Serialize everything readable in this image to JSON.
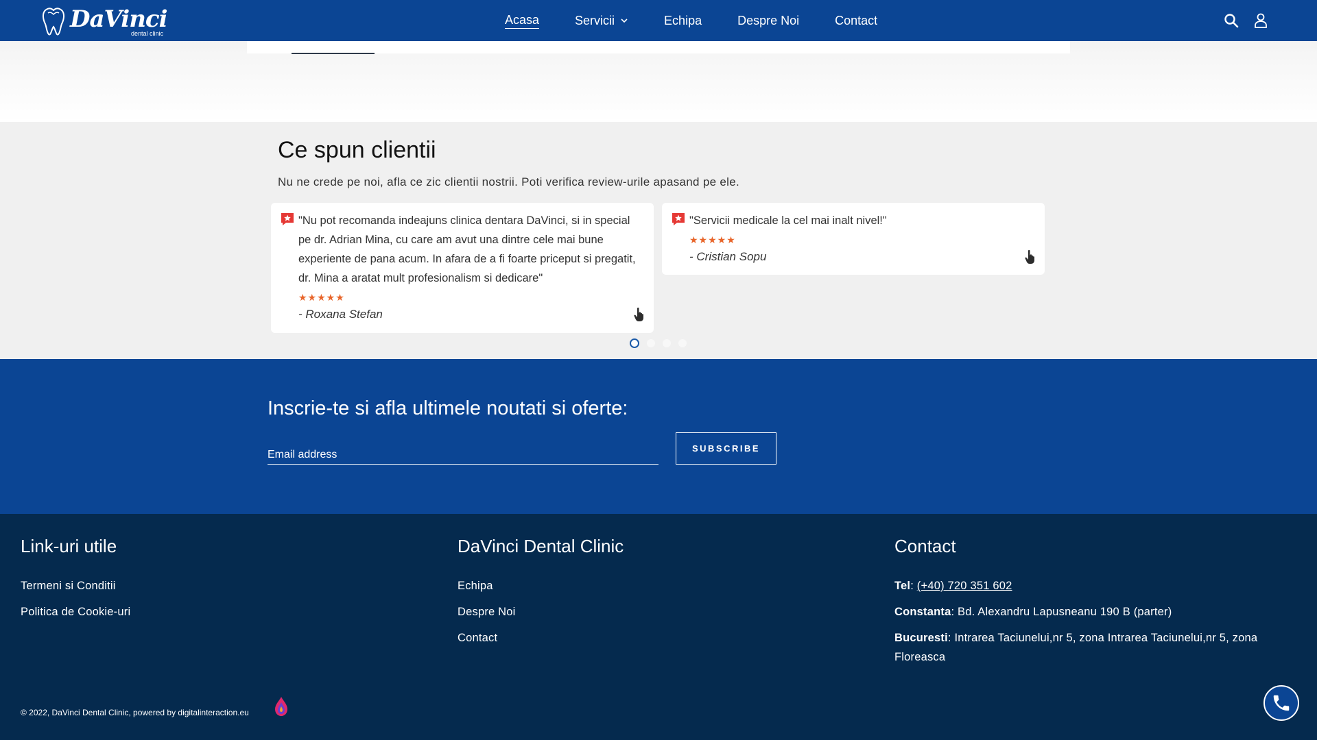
{
  "header": {
    "logo": {
      "name": "DaVinci",
      "sub": "dental clinic"
    },
    "nav": [
      {
        "label": "Acasa"
      },
      {
        "label": "Servicii"
      },
      {
        "label": "Echipa"
      },
      {
        "label": "Despre Noi"
      },
      {
        "label": "Contact"
      }
    ],
    "icons": {
      "search": "search-icon",
      "account": "account-icon"
    }
  },
  "testimonials": {
    "title": "Ce spun clientii",
    "subtitle": "Nu ne crede pe noi, afla ce zic clientii nostrii. Poti verifica review-urile apasand pe ele.",
    "reviews": [
      {
        "quote": "\"Nu pot recomanda indeajuns clinica dentara DaVinci, si in special pe dr. Adrian Mina, cu care am avut una dintre cele mai bune experiente de pana acum. In afara de a fi foarte priceput si pregatit, dr. Mina a aratat mult profesionalism si dedicare\"",
        "stars": "★★★★★",
        "rating": 5,
        "author": "- Roxana Stefan"
      },
      {
        "quote": "\"Servicii medicale la cel mai inalt nivel!\"",
        "stars": "★★★★★",
        "rating": 5,
        "author": "- Cristian Sopu"
      }
    ],
    "pagination": {
      "count": 4,
      "active": 1
    }
  },
  "newsletter": {
    "title": "Inscrie-te si afla ultimele noutati si oferte:",
    "email_placeholder": "Email address",
    "button": "SUBSCRIBE"
  },
  "footer": {
    "col1": {
      "heading": "Link-uri utile",
      "links": [
        "Termeni si Conditii",
        "Politica de Cookie-uri"
      ]
    },
    "col2": {
      "heading": "DaVinci Dental Clinic",
      "links": [
        "Echipa",
        "Despre Noi",
        "Contact"
      ]
    },
    "col3": {
      "heading": "Contact",
      "tel_label": "Tel",
      "tel_value": "(+40) 720 351 602",
      "constanta_label": "Constanta",
      "constanta_value": ": Bd. Alexandru Lapusneanu 190 B (parter)",
      "bucuresti_label": "Bucuresti",
      "bucuresti_value": ": Intrarea Taciunelui,nr 5, zona Intrarea Taciunelui,nr 5, zona Floreasca"
    },
    "copyright": "© 2022, DaVinci Dental Clinic, powered by digitalinteraction.eu"
  },
  "colors": {
    "primary": "#0b4594",
    "footer": "#052a4e",
    "star": "#e8652a",
    "testimonial_bg": "#f0f0f0"
  }
}
